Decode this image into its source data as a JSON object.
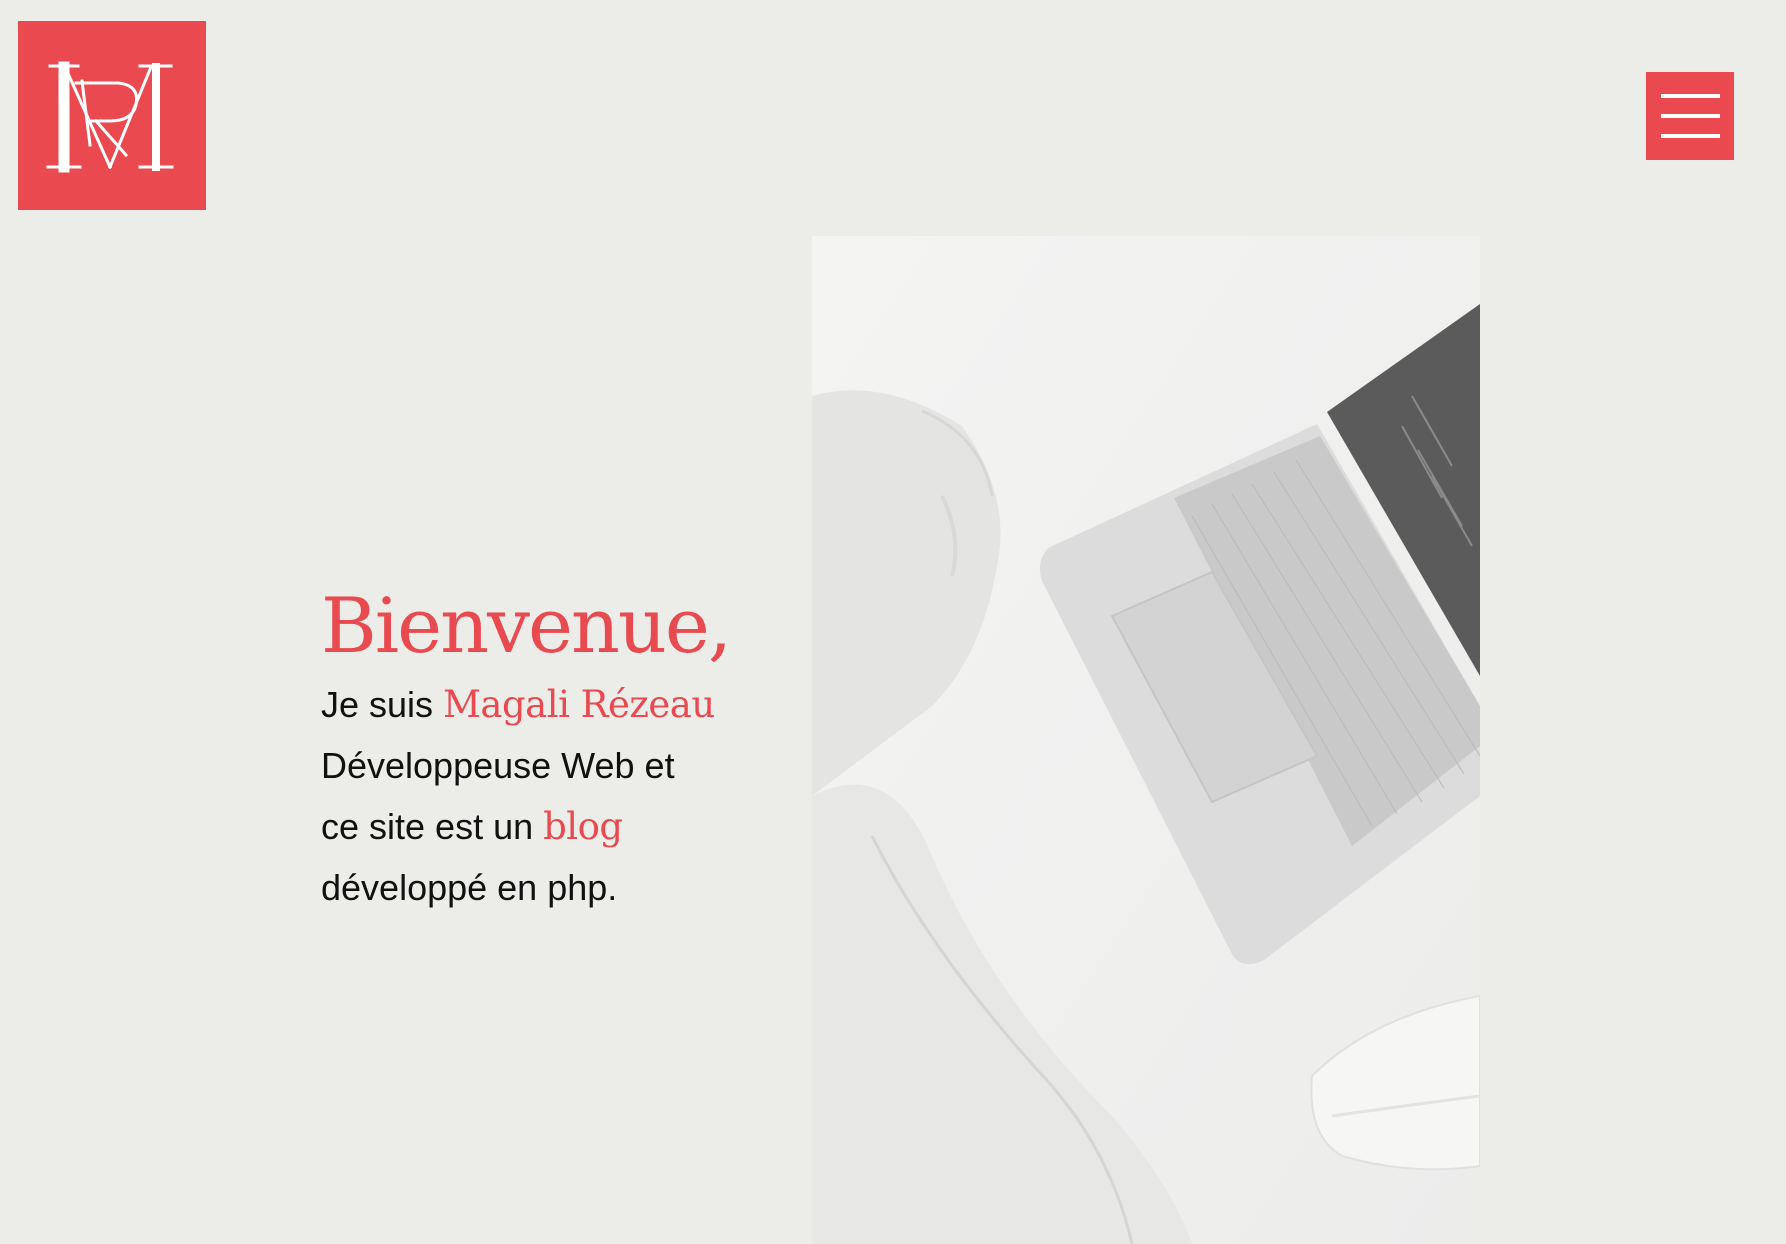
{
  "logo": {
    "monogram": "MR",
    "alt": "logo"
  },
  "menu": {
    "label": "menu"
  },
  "intro": {
    "title": "Bienvenue,",
    "line1_prefix": "Je suis ",
    "name": "Magali Rézeau",
    "line2": "Développeuse Web et",
    "line3_prefix": "ce site est un ",
    "blog": "blog",
    "line4": "développé en php."
  },
  "colors": {
    "accent": "#ea4a4f",
    "background": "#ecece8",
    "text": "#111111"
  },
  "icons": {
    "menu": "hamburger-icon",
    "logo": "monogram-logo"
  }
}
